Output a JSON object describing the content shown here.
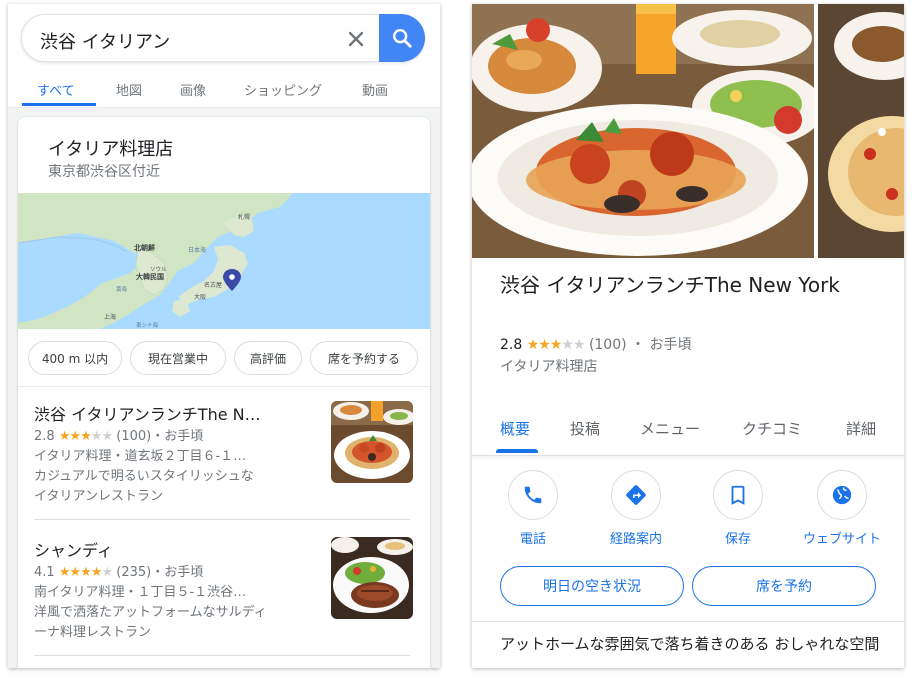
{
  "search": {
    "query": "渋谷 イタリアン"
  },
  "tabs": [
    "すべて",
    "地図",
    "画像",
    "ショッピング",
    "動画"
  ],
  "local": {
    "title": "イタリア料理店",
    "subtitle": "東京都渋谷区付近",
    "map_labels": [
      "札幌",
      "北朝鮮",
      "日本海",
      "ソウル",
      "大韓民国",
      "名古屋",
      "大阪",
      "黄海",
      "上海",
      "東シナ海"
    ],
    "chips": [
      "400 m 以内",
      "現在営業中",
      "高評価",
      "席を予約する"
    ],
    "results": [
      {
        "name": "渋谷 イタリアンランチThe N…",
        "rating": "2.8",
        "stars_filled": 3,
        "reviews": "(100)",
        "price": "・お手頃",
        "line1": "イタリア料理・道玄坂２丁目６-１…",
        "line2": "カジュアルで明るいスタイリッシュな",
        "line3": "イタリアンレストラン"
      },
      {
        "name": "シャンディ",
        "rating": "4.1",
        "stars_filled": 4,
        "reviews": "(235)",
        "price": "・お手頃",
        "line1": "南イタリア料理・１丁目５-１渋谷…",
        "line2": "洋風で洒落たアットフォームなサルディ",
        "line3": "ーナ料理レストラン"
      }
    ]
  },
  "place": {
    "title": "渋谷 イタリアンランチThe New York",
    "rating": "2.8",
    "stars_filled": 3,
    "reviews": "(100)",
    "price": "・ お手頃",
    "category": "イタリア料理店",
    "tabs": [
      "概要",
      "投稿",
      "メニュー",
      "クチコミ",
      "詳細"
    ],
    "actions": [
      {
        "label": "電話",
        "icon": "phone-icon"
      },
      {
        "label": "経路案内",
        "icon": "directions-icon"
      },
      {
        "label": "保存",
        "icon": "bookmark-icon"
      },
      {
        "label": "ウェブサイト",
        "icon": "globe-icon"
      }
    ],
    "buttons": [
      "明日の空き状況",
      "席を予約"
    ],
    "description": "アットホームな雰囲気で落ち着きのある おしゃれな空間"
  },
  "colors": {
    "accent": "#1a73e8",
    "search_button": "#4285f4",
    "star": "#f5a623",
    "pin": "#3b4aa8"
  }
}
